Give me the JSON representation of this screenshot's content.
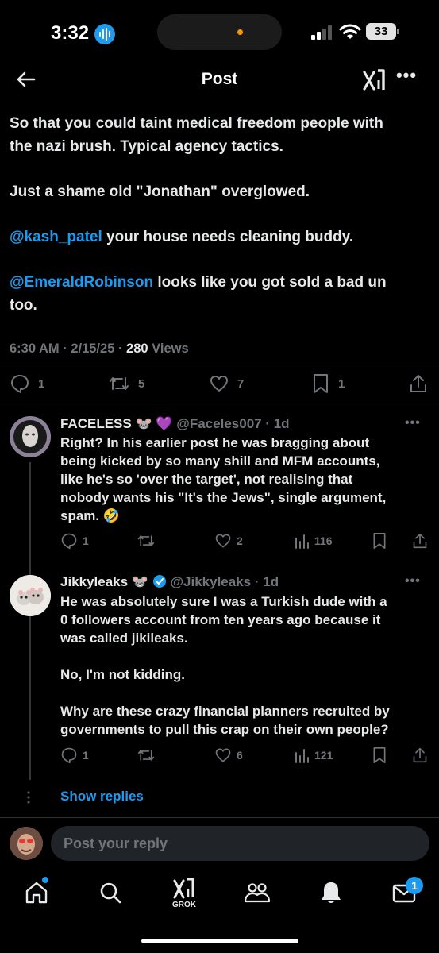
{
  "status_bar": {
    "time": "3:32",
    "battery": "33"
  },
  "header": {
    "title": "Post",
    "back_icon": "arrow-left-icon",
    "grok_icon": "grok-icon",
    "more": "•••"
  },
  "post": {
    "paragraphs": [
      [
        "So that you could taint medical freedom people with",
        "the nazi brush. Typical agency tactics."
      ],
      [
        "Just a shame old \"Jonathan\" overglowed."
      ]
    ],
    "mention1": "@kash_patel",
    "mention1_rest": " your house needs cleaning buddy.",
    "mention2": "@EmeraldRobinson",
    "mention2_rest": " looks like you got sold a bad un",
    "mention2_line2": "too.",
    "time": "6:30 AM · 2/15/25 · ",
    "views_count": "280",
    "views_label": " Views",
    "stats": {
      "replies": "1",
      "reposts": "5",
      "likes": "7",
      "bookmarks": "1"
    }
  },
  "replies": [
    {
      "name": "FACELESS",
      "emojis": "🐭 💜",
      "handle": "@Faceles007 · 1d",
      "lines": [
        "Right? In his earlier post he was bragging about",
        "being kicked by so many shill and MFM accounts,",
        "like he's so 'over the target', not realising that",
        "nobody wants his \"It's the Jews\", single argument,",
        "spam. 🤣"
      ],
      "stats": {
        "replies": "1",
        "reposts": "",
        "likes": "2",
        "views": "116"
      }
    },
    {
      "name": "Jikkyleaks",
      "emojis": "🐭",
      "handle": "@Jikkyleaks · 1d",
      "lines": [
        "He was absolutely sure I was a Turkish dude with a",
        "0 followers account from ten years ago because it",
        "was called jikileaks.",
        "",
        "No, I'm not kidding.",
        "",
        "Why are these crazy financial planners recruited by",
        "governments to pull this crap on their own people?"
      ],
      "stats": {
        "replies": "1",
        "reposts": "",
        "likes": "6",
        "views": "121"
      }
    }
  ],
  "show_replies": "Show replies",
  "composer": {
    "placeholder": "Post your reply"
  },
  "tabbar": {
    "items": [
      "home-icon",
      "search-icon",
      "grok-icon",
      "communities-icon",
      "notifications-icon",
      "messages-icon"
    ],
    "grok_label": "GROK",
    "messages_badge": "1"
  },
  "colors": {
    "accent": "#1d9bf0",
    "background": "#000000",
    "text": "#e7e9ea",
    "muted": "#71767b"
  }
}
